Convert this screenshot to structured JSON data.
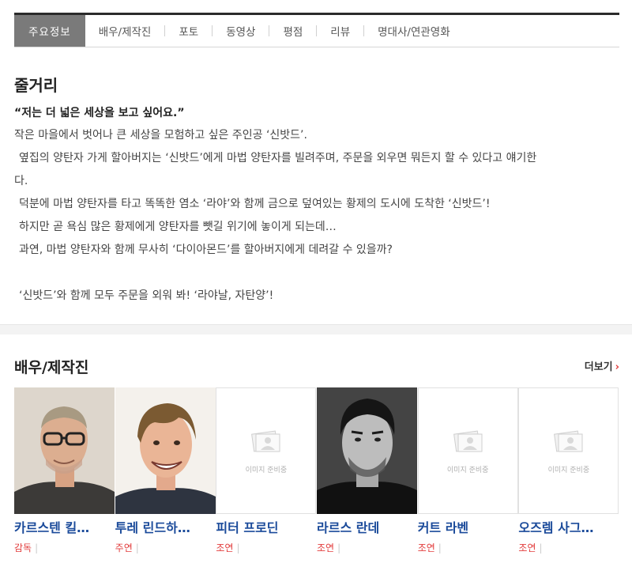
{
  "tabs": [
    {
      "label": "주요정보",
      "active": true
    },
    {
      "label": "배우/제작진",
      "active": false
    },
    {
      "label": "포토",
      "active": false
    },
    {
      "label": "동영상",
      "active": false
    },
    {
      "label": "평점",
      "active": false
    },
    {
      "label": "리뷰",
      "active": false
    },
    {
      "label": "명대사/연관영화",
      "active": false
    }
  ],
  "synopsis": {
    "title": "줄거리",
    "tagline": "“저는 더 넓은 세상을 보고 싶어요.”",
    "lines": [
      "작은 마을에서 벗어나 큰 세상을 모험하고 싶은 주인공 ‘신밧드’.",
      "옆집의 양탄자 가게 할아버지는 ‘신밧드’에게 마법 양탄자를 빌려주며, 주문을 외우면 뭐든지 할 수 있다고 얘기한",
      "다.",
      "덕분에 마법 양탄자를 타고 똑똑한 염소 ‘라야’와 함께 금으로 덮여있는 황제의 도시에 도착한 ‘신밧드’!",
      "하지만 곧 욕심 많은 황제에게 양탄자를 뺏길 위기에 놓이게 되는데…",
      "과연, 마법 양탄자와 함께 무사히 ‘다이아몬드’를 할아버지에게 데려갈 수 있을까?",
      "",
      "‘신밧드’와 함께 모두 주문을 외워 봐! ‘라야날, 자탄양’!"
    ]
  },
  "cast": {
    "title": "배우/제작진",
    "more_label": "더보기",
    "placeholder_text": "이미지 준비중",
    "people": [
      {
        "name": "카르스텐 킬…",
        "role": "감독",
        "photo": "man-glasses"
      },
      {
        "name": "투레 린드하…",
        "role": "주연",
        "photo": "man-smile"
      },
      {
        "name": "피터 프로딘",
        "role": "조연",
        "photo": "placeholder"
      },
      {
        "name": "라르스 란데",
        "role": "조연",
        "photo": "man-bw"
      },
      {
        "name": "커트 라벤",
        "role": "조연",
        "photo": "placeholder"
      },
      {
        "name": "오즈렘 사그…",
        "role": "조연",
        "photo": "placeholder"
      }
    ]
  },
  "colors": {
    "accent_red": "#e23d3d",
    "link_blue": "#1a4a9a",
    "active_tab": "#7a7a7a"
  }
}
